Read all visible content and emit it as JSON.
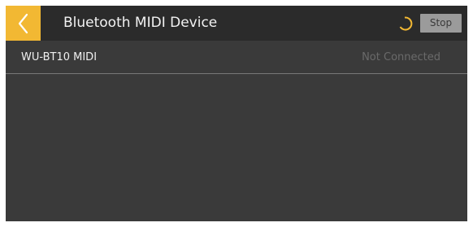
{
  "header": {
    "title": "Bluetooth MIDI Device",
    "back_icon": "chevron-left-icon",
    "spinner_icon": "loading-spinner-icon",
    "stop_label": "Stop"
  },
  "devices": [
    {
      "name": "WU-BT10 MIDI",
      "status": "Not Connected"
    }
  ],
  "colors": {
    "accent": "#f2b833",
    "header_bg": "#2b2b2b",
    "content_bg": "#3a3a3a",
    "stop_button_bg": "#9b9b9b",
    "status_text": "#6a6a6a"
  }
}
